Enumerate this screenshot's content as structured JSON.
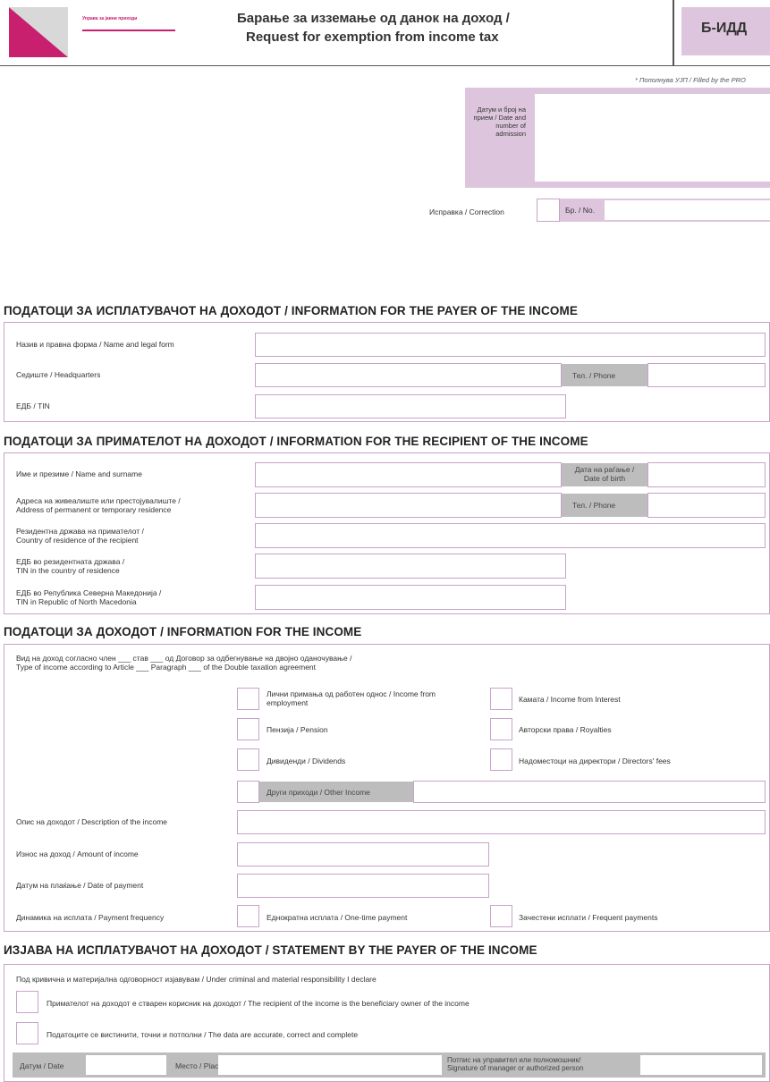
{
  "header": {
    "org_name": "Управа за јавни приходи",
    "title_mk": "Барање за изземање од данок на доход /",
    "title_en": "Request for exemption from income tax",
    "form_code": "Б-ИДД"
  },
  "admin": {
    "filled_by": "* Пополнува УЈП / Filled by the PRO",
    "date_number_label": "Датум и број на прием / Date and number of admission",
    "correction_label": "Исправка / Correction",
    "no_label": "Бр. / No."
  },
  "payer": {
    "title": "ПОДАТОЦИ ЗА ИСПЛАТУВАЧОТ НА ДОХОДОТ / INFORMATION FOR THE PAYER OF THE INCOME",
    "name_label": "Назив и правна форма / Name and legal form",
    "hq_label": "Седиште / Headquarters",
    "phone_label": "Тел. / Phone",
    "tin_label": "ЕДБ / TIN"
  },
  "recipient": {
    "title": "ПОДАТОЦИ ЗА ПРИМАТЕЛОТ НА ДОХОДОТ / INFORMATION FOR THE RECIPIENT OF THE INCOME",
    "name_label": "Име и презиме / Name and surname",
    "dob_label_1": "Дата на раѓање /",
    "dob_label_2": "Date of birth",
    "address_label_1": "Адреса на живеалиште или престојувалиште /",
    "address_label_2": "Address of permanent or temporary residence",
    "phone_label": "Тел. / Phone",
    "country_label_1": "Резидентна држава на примателот /",
    "country_label_2": "Country of residence of the recipient",
    "tin_res_label_1": "ЕДБ во резидентната држава /",
    "tin_res_label_2": "TIN in the country of residence",
    "tin_mk_label_1": "ЕДБ во Република Северна Македонија /",
    "tin_mk_label_2": "TIN in Republic of North Macedonia"
  },
  "income": {
    "title": "ПОДАТОЦИ ЗА ДОХОДОТ / INFORMATION FOR THE INCOME",
    "type_line_1": "Вид на доход согласно член ___ став ___ од Договор за одбегнување на двојно оданочување /",
    "type_line_2": "Type of income according to Article ___ Paragraph ___ of the Double taxation agreement",
    "employment_1": "Лични примања од работен однос / Income from",
    "employment_2": "employment",
    "interest": "Камата / Income from Interest",
    "pension": "Пензија / Pension",
    "royalties": "Авторски права / Royalties",
    "dividends": "Дивиденди / Dividends",
    "directors": "Надоместоци на директори / Directors' fees",
    "other": "Други приходи / Other Income",
    "description_label": "Опис на доходот / Description of the income",
    "amount_label": "Износ на доход / Amount of income",
    "date_label": "Датум на плаќање / Date of payment",
    "frequency_label": "Динамика на исплата / Payment frequency",
    "one_time": "Еднократна исплата / One-time payment",
    "frequent": "Зачестени исплати / Frequent payments"
  },
  "statement": {
    "title": "ИЗЈАВА НА ИСПЛАТУВАЧОТ НА ДОХОДОТ / STATEMENT BY THE PAYER OF THE INCOME",
    "declare": "Под кривична и материјална одговорност изјавувам / Under criminal and material responsibility I declare",
    "beneficial": "Примателот на доходот е стварен корисник на доходот / The recipient of the income is the beneficiary owner of the income",
    "accurate": "Податоците се вистинити, точни и потполни / The data are accurate, correct and complete",
    "date_label": "Датум / Date",
    "place_label": "Место / Place",
    "signature_1": "Потпис на управител или полномошник/",
    "signature_2": "Signature of manager or authorized person"
  },
  "colors": {
    "accent": "#c9a2c9",
    "title_box": "#ddc6dd",
    "grey_label": "#bdbdbd",
    "logo_magenta": "#c8206e"
  }
}
